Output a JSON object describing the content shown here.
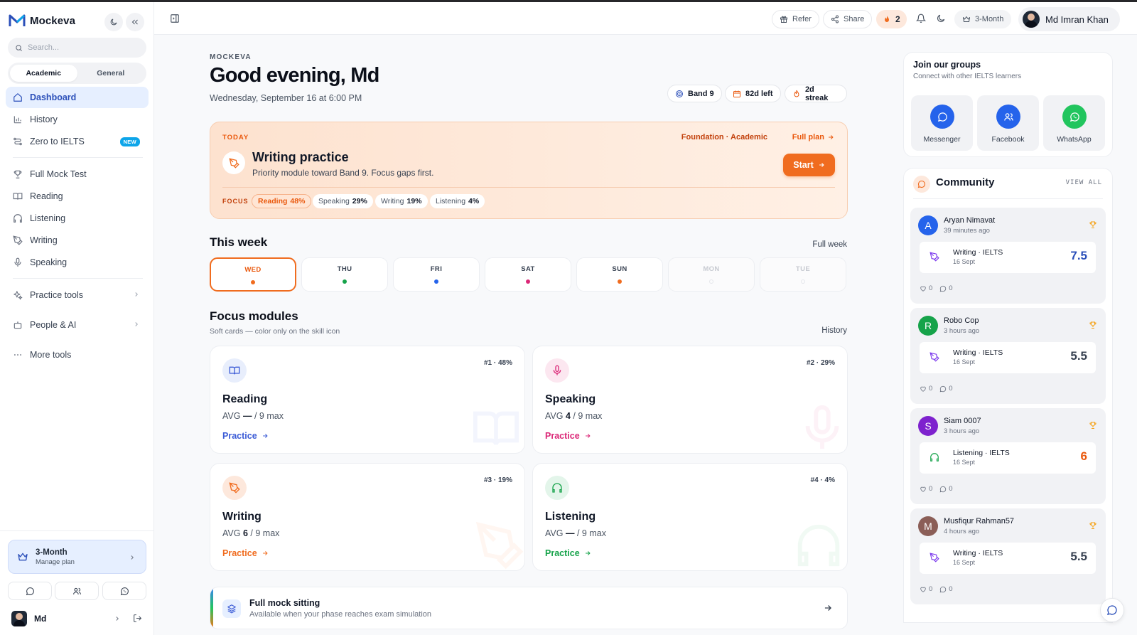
{
  "app": {
    "name": "Mockeva"
  },
  "sidebar": {
    "search_placeholder": "Search...",
    "segments": [
      "Academic",
      "General"
    ],
    "items": [
      {
        "label": "Dashboard"
      },
      {
        "label": "History"
      },
      {
        "label": "Zero to IELTS",
        "badge": "NEW"
      },
      {
        "label": "Full Mock Test"
      },
      {
        "label": "Reading"
      },
      {
        "label": "Listening"
      },
      {
        "label": "Writing"
      },
      {
        "label": "Speaking"
      },
      {
        "label": "Practice tools"
      },
      {
        "label": "People & AI"
      },
      {
        "label": "More tools"
      }
    ],
    "plan": {
      "title": "3-Month",
      "subtitle": "Manage plan"
    },
    "user": {
      "name": "Md"
    }
  },
  "topbar": {
    "refer": "Refer",
    "share": "Share",
    "streak_count": "2",
    "plan": "3-Month",
    "user_name": "Md Imran Khan"
  },
  "header": {
    "eyebrow": "MOCKEVA",
    "greeting": "Good evening, Md",
    "date": "Wednesday, September 16 at 6:00 PM",
    "stats": [
      "Band 9",
      "82d left",
      "2d streak"
    ]
  },
  "today": {
    "label": "TODAY",
    "meta": "Foundation · Academic",
    "full_plan": "Full plan",
    "title": "Writing practice",
    "subtitle": "Priority module toward Band 9. Focus gaps first.",
    "start": "Start",
    "focus_label": "FOCUS",
    "focus": [
      {
        "skill": "Reading",
        "pct": "48%"
      },
      {
        "skill": "Speaking",
        "pct": "29%"
      },
      {
        "skill": "Writing",
        "pct": "19%"
      },
      {
        "skill": "Listening",
        "pct": "4%"
      }
    ]
  },
  "week": {
    "title": "This week",
    "link": "Full week",
    "days": [
      {
        "name": "WED",
        "dot": "#f06c1f"
      },
      {
        "name": "THU",
        "dot": "#16a34a"
      },
      {
        "name": "FRI",
        "dot": "#2563eb"
      },
      {
        "name": "SAT",
        "dot": "#db2777"
      },
      {
        "name": "SUN",
        "dot": "#f06c1f"
      },
      {
        "name": "MON",
        "dot": ""
      },
      {
        "name": "TUE",
        "dot": ""
      }
    ]
  },
  "focus_modules": {
    "title": "Focus modules",
    "subtitle": "Soft cards — color only on the skill icon",
    "link": "History",
    "modules": [
      {
        "name": "Reading",
        "rank": "#1 · 48%",
        "avg_label": "AVG",
        "avg": "—",
        "max": "/ 9 max",
        "action": "Practice",
        "color": "#3b5bd6",
        "tint": "#e8eefc",
        "icon": "book-icon"
      },
      {
        "name": "Speaking",
        "rank": "#2 · 29%",
        "avg_label": "AVG",
        "avg": "4",
        "max": "/ 9 max",
        "action": "Practice",
        "color": "#db2777",
        "tint": "#fce7f0",
        "icon": "mic-icon"
      },
      {
        "name": "Writing",
        "rank": "#3 · 19%",
        "avg_label": "AVG",
        "avg": "6",
        "max": "/ 9 max",
        "action": "Practice",
        "color": "#f06c1f",
        "tint": "#fde8dc",
        "icon": "pen-icon"
      },
      {
        "name": "Listening",
        "rank": "#4 · 4%",
        "avg_label": "AVG",
        "avg": "—",
        "max": "/ 9 max",
        "action": "Practice",
        "color": "#16a34a",
        "tint": "#e3f5ea",
        "icon": "headphones-icon"
      }
    ]
  },
  "mock": {
    "title": "Full mock sitting",
    "subtitle": "Available when your phase reaches exam simulation"
  },
  "groups": {
    "title": "Join our groups",
    "subtitle": "Connect with other IELTS learners",
    "items": [
      {
        "label": "Messenger",
        "color": "#2563eb"
      },
      {
        "label": "Facebook",
        "color": "#2563eb"
      },
      {
        "label": "WhatsApp",
        "color": "#22c55e"
      }
    ]
  },
  "community": {
    "title": "Community",
    "view_all": "VIEW ALL",
    "posts": [
      {
        "initial": "A",
        "name": "Aryan Nimavat",
        "time": "39 minutes ago",
        "avatar_color": "#2563eb",
        "module": "Writing · IELTS",
        "date": "16 Sept",
        "score": "7.5",
        "score_color": "#2b4fb9",
        "icon": "pen-icon",
        "icon_color": "#7c3aed",
        "likes": "0",
        "comments": "0"
      },
      {
        "initial": "R",
        "name": "Robo Cop",
        "time": "3 hours ago",
        "avatar_color": "#16a34a",
        "module": "Writing · IELTS",
        "date": "16 Sept",
        "score": "5.5",
        "score_color": "#374151",
        "icon": "pen-icon",
        "icon_color": "#7c3aed",
        "likes": "0",
        "comments": "0"
      },
      {
        "initial": "S",
        "name": "Siam 0007",
        "time": "3 hours ago",
        "avatar_color": "#7e22ce",
        "module": "Listening · IELTS",
        "date": "16 Sept",
        "score": "6",
        "score_color": "#ea580c",
        "icon": "headphones-icon",
        "icon_color": "#16a34a",
        "likes": "0",
        "comments": "0"
      },
      {
        "initial": "M",
        "name": "Musfiqur Rahman57",
        "time": "4 hours ago",
        "avatar_color": "#8b5e57",
        "module": "Writing · IELTS",
        "date": "16 Sept",
        "score": "5.5",
        "score_color": "#374151",
        "icon": "pen-icon",
        "icon_color": "#7c3aed",
        "likes": "0",
        "comments": "0"
      }
    ]
  }
}
